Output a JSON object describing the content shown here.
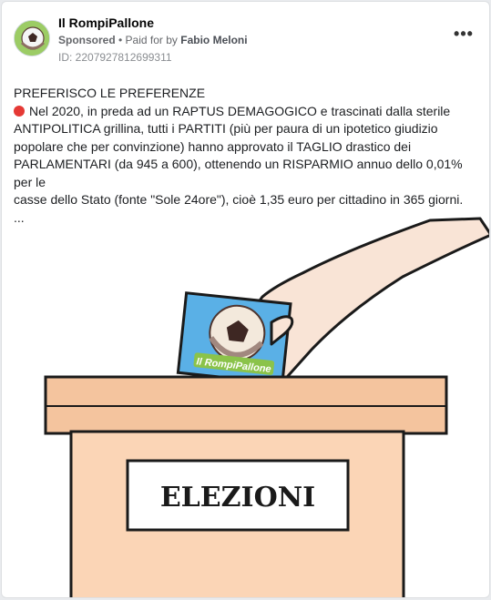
{
  "post": {
    "page_name": "Il RompiPallone",
    "sponsored_label": "Sponsored",
    "separator": " • ",
    "paid_for_prefix": "Paid for by ",
    "payer_name": "Fabio Meloni",
    "ad_id": "ID: 2207927812699311",
    "more_icon": "more-options-icon",
    "headline": "PREFERISCO LE PREFERENZE",
    "body_lines": [
      "Nel 2020, in preda ad un RAPTUS DEMAGOGICO e trascinati dalla sterile",
      "ANTIPOLITICA grillina, tutti i PARTITI (più per paura di un ipotetico giudizio",
      "popolare che per convinzione) hanno approvato il TAGLIO drastico dei",
      "PARLAMENTARI (da 945 a 600), ottenendo un RISPARMIO annuo dello 0,01% per le",
      "casse dello Stato (fonte \"Sole 24ore\"), cioè 1,35 euro per cittadino in 365 giorni."
    ],
    "see_more": "..."
  },
  "image": {
    "ballot_logo_text": "Il RompiPallone",
    "box_label": "ELEZIONI"
  },
  "colors": {
    "box_fill": "#fbd5b6",
    "box_lid": "#f4c49e",
    "ballot_blue": "#5ab0e6",
    "hand_fill": "#f9e4d6",
    "red_dot": "#e53935"
  }
}
